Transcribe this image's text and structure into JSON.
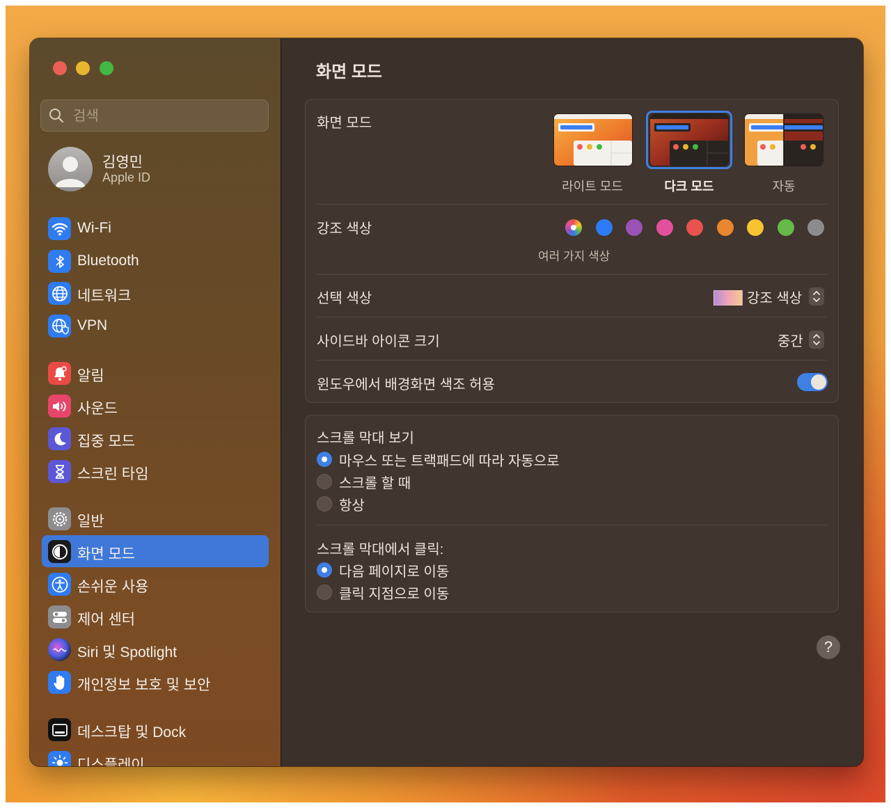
{
  "sidebar": {
    "search_placeholder": "검색",
    "profile": {
      "name": "김영민",
      "subtitle": "Apple ID"
    },
    "items": [
      {
        "label": "Wi-Fi",
        "icon": "wifi-icon"
      },
      {
        "label": "Bluetooth",
        "icon": "bluetooth-icon"
      },
      {
        "label": "네트워크",
        "icon": "globe-icon"
      },
      {
        "label": "VPN",
        "icon": "vpn-globe-icon"
      },
      {
        "label": "알림",
        "icon": "bell-icon"
      },
      {
        "label": "사운드",
        "icon": "speaker-icon"
      },
      {
        "label": "집중 모드",
        "icon": "moon-icon"
      },
      {
        "label": "스크린 타임",
        "icon": "hourglass-icon"
      },
      {
        "label": "일반",
        "icon": "gear-icon"
      },
      {
        "label": "화면 모드",
        "icon": "appearance-icon",
        "selected": true
      },
      {
        "label": "손쉬운 사용",
        "icon": "accessibility-icon"
      },
      {
        "label": "제어 센터",
        "icon": "toggles-icon"
      },
      {
        "label": "Siri 및 Spotlight",
        "icon": "siri-icon"
      },
      {
        "label": "개인정보 보호 및 보안",
        "icon": "hand-icon"
      },
      {
        "label": "데스크탑 및 Dock",
        "icon": "dock-icon"
      },
      {
        "label": "디스플레이",
        "icon": "sun-icon"
      }
    ]
  },
  "main": {
    "title": "화면 모드",
    "appearance": {
      "label": "화면 모드",
      "options": [
        {
          "label": "라이트 모드",
          "selected": false
        },
        {
          "label": "다크 모드",
          "selected": true
        },
        {
          "label": "자동",
          "selected": false
        }
      ]
    },
    "accent": {
      "label": "강조 색상",
      "caption": "여러 가지 색상",
      "colors": [
        "multicolor",
        "#2f7bf5",
        "#9b52b5",
        "#e3509b",
        "#e9524f",
        "#e9862f",
        "#f6c431",
        "#66ba48",
        "#8c8c8c"
      ]
    },
    "highlight": {
      "label": "선택 색상",
      "value": "강조 색상"
    },
    "sidebar_icon_size": {
      "label": "사이드바 아이콘 크기",
      "value": "중간"
    },
    "wallpaper_tinting": {
      "label": "윈도우에서 배경화면 색조 허용",
      "enabled": true
    },
    "scrollbars": {
      "label": "스크롤 막대 보기",
      "options": [
        {
          "label": "마우스 또는 트랙패드에 따라 자동으로",
          "selected": true
        },
        {
          "label": "스크롤 할 때",
          "selected": false
        },
        {
          "label": "항상",
          "selected": false
        }
      ]
    },
    "scroll_click": {
      "label": "스크롤 막대에서 클릭:",
      "options": [
        {
          "label": "다음 페이지로 이동",
          "selected": true
        },
        {
          "label": "클릭 지점으로 이동",
          "selected": false
        }
      ]
    },
    "help_label": "?"
  }
}
